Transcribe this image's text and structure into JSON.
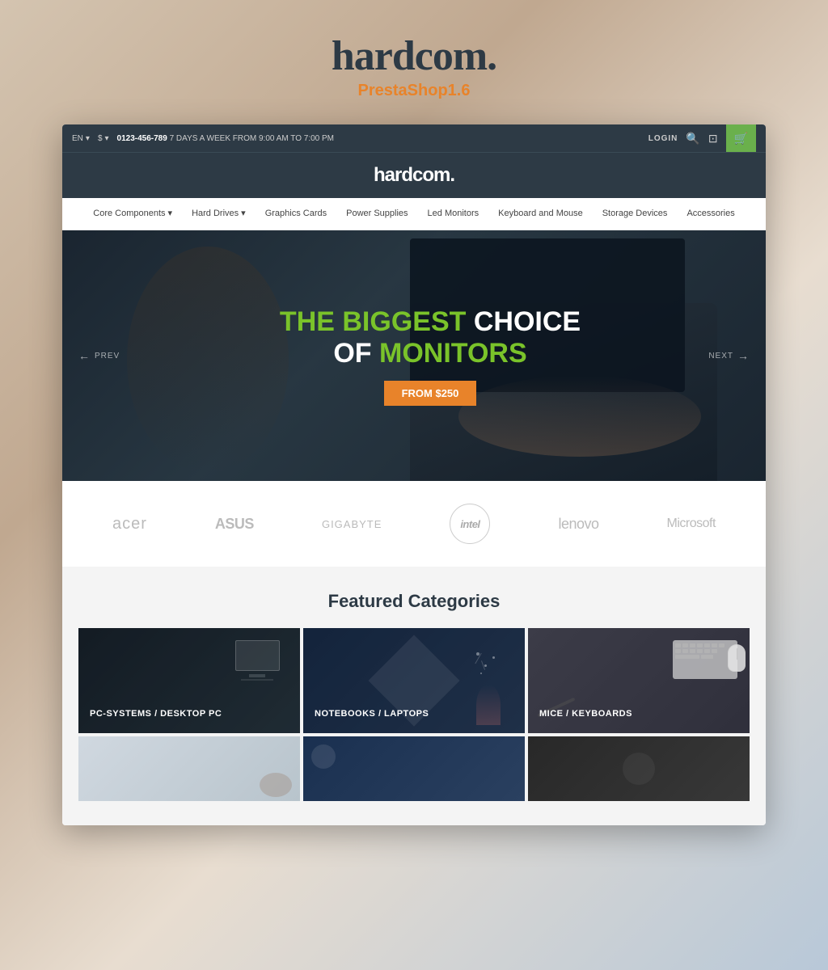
{
  "site": {
    "logo": "hardcom.",
    "subtitle": "PrestaShop1.6"
  },
  "topbar": {
    "lang": "EN",
    "lang_arrow": "▾",
    "currency": "$",
    "currency_arrow": "▾",
    "phone": "0123-456-789",
    "phone_suffix": "7 DAYS A WEEK FROM 9:00 AM TO 7:00 PM",
    "login": "LOGIN",
    "search_icon": "🔍",
    "wishlist_icon": "⊡",
    "cart_icon": "🛒"
  },
  "header": {
    "logo": "hardcom."
  },
  "nav": {
    "items": [
      {
        "label": "Core Components",
        "has_arrow": true
      },
      {
        "label": "Hard Drives",
        "has_arrow": true
      },
      {
        "label": "Graphics Cards",
        "has_arrow": false
      },
      {
        "label": "Power Supplies",
        "has_arrow": false
      },
      {
        "label": "Led Monitors",
        "has_arrow": false
      },
      {
        "label": "Keyboard and Mouse",
        "has_arrow": false
      },
      {
        "label": "Storage Devices",
        "has_arrow": false
      },
      {
        "label": "Accessories",
        "has_arrow": false
      }
    ]
  },
  "hero": {
    "line1_green": "THE BIGGEST",
    "line1_white": " CHOICE",
    "line2_white": "OF ",
    "line2_green": "MONITORS",
    "cta": "FROM $250",
    "prev": "PREV",
    "next": "NEXT"
  },
  "brands": [
    {
      "name": "acer",
      "style": "acer"
    },
    {
      "name": "ASUS",
      "style": "asus"
    },
    {
      "name": "GIGABYTE",
      "style": "gigabyte"
    },
    {
      "name": "intel",
      "style": "intel"
    },
    {
      "name": "lenovo",
      "style": "lenovo"
    },
    {
      "name": "Microsoft",
      "style": "microsoft"
    }
  ],
  "featured": {
    "title": "Featured Categories",
    "categories": [
      {
        "label": "PC-SYSTEMS / DESKTOP PC",
        "bg": "dark"
      },
      {
        "label": "NOTEBOOKS / LAPTOPS",
        "bg": "blue"
      },
      {
        "label": "MICE / KEYBOARDS",
        "bg": "grey"
      }
    ],
    "categories_row2": [
      {
        "label": "",
        "bg": "light"
      },
      {
        "label": "",
        "bg": "tech"
      },
      {
        "label": "",
        "bg": "dark2"
      }
    ]
  }
}
